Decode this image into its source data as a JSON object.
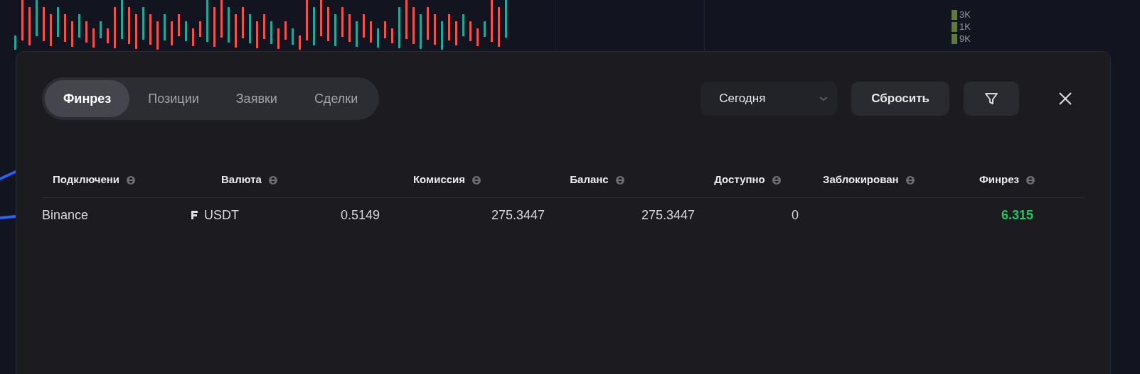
{
  "orderbook_volumes": [
    "3K",
    "1K",
    "9K"
  ],
  "tabs": [
    {
      "label": "Финрез",
      "selected": true
    },
    {
      "label": "Позиции",
      "selected": false
    },
    {
      "label": "Заявки",
      "selected": false
    },
    {
      "label": "Сделки",
      "selected": false
    }
  ],
  "period_select": {
    "value": "Сегодня"
  },
  "reset_button": "Сбросить",
  "table": {
    "columns": [
      "Подключени",
      "Валюта",
      "Комиссия",
      "Баланс",
      "Доступно",
      "Заблокирован",
      "Финрез"
    ],
    "rows": [
      {
        "connection": "Binance",
        "currency": "USDT",
        "commission": "0.5149",
        "balance": "275.3447",
        "available": "275.3447",
        "blocked": "0",
        "pnl": "6.315",
        "pnl_positive": true
      }
    ]
  }
}
